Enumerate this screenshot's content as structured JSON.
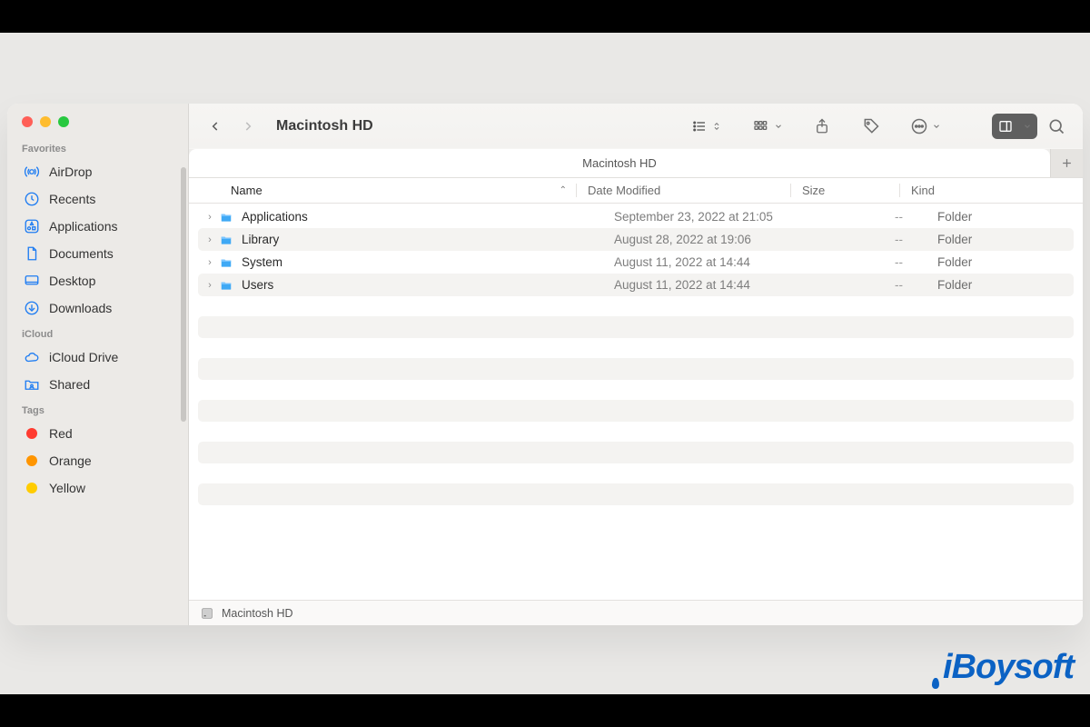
{
  "window": {
    "title": "Macintosh HD",
    "tab_label": "Macintosh HD",
    "path_label": "Macintosh HD"
  },
  "sidebar": {
    "sections": {
      "favorites": {
        "title": "Favorites",
        "items": [
          {
            "label": "AirDrop"
          },
          {
            "label": "Recents"
          },
          {
            "label": "Applications"
          },
          {
            "label": "Documents"
          },
          {
            "label": "Desktop"
          },
          {
            "label": "Downloads"
          }
        ]
      },
      "icloud": {
        "title": "iCloud",
        "items": [
          {
            "label": "iCloud Drive"
          },
          {
            "label": "Shared"
          }
        ]
      },
      "tags": {
        "title": "Tags",
        "items": [
          {
            "label": "Red",
            "color": "#ff3b30"
          },
          {
            "label": "Orange",
            "color": "#ff9500"
          },
          {
            "label": "Yellow",
            "color": "#ffcc00"
          }
        ]
      }
    }
  },
  "columns": {
    "name": "Name",
    "date": "Date Modified",
    "size": "Size",
    "kind": "Kind"
  },
  "rows": [
    {
      "name": "Applications",
      "date": "September 23, 2022 at 21:05",
      "size": "--",
      "kind": "Folder"
    },
    {
      "name": "Library",
      "date": "August 28, 2022 at 19:06",
      "size": "--",
      "kind": "Folder"
    },
    {
      "name": "System",
      "date": "August 11, 2022 at 14:44",
      "size": "--",
      "kind": "Folder"
    },
    {
      "name": "Users",
      "date": "August 11, 2022 at 14:44",
      "size": "--",
      "kind": "Folder"
    }
  ],
  "watermark": "iBoysoft"
}
